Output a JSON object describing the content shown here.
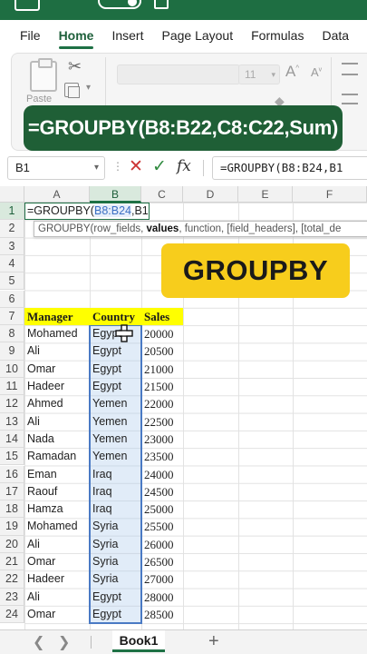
{
  "menu": [
    "File",
    "Home",
    "Insert",
    "Page Layout",
    "Formulas",
    "Data"
  ],
  "menu_active": "Home",
  "ribbon": {
    "paste_label": "Paste",
    "font_size": "11"
  },
  "banner": "=GROUPBY(B8:B22,C8:C22,Sum)",
  "formula_bar": {
    "name_box": "B1",
    "formula": "=GROUPBY(B8:B24,B1"
  },
  "columns": [
    "A",
    "B",
    "C",
    "D",
    "E",
    "F"
  ],
  "selected_column": "B",
  "rows": [
    "1",
    "2",
    "3",
    "4",
    "5",
    "6",
    "7",
    "8",
    "9",
    "10",
    "11",
    "12",
    "13",
    "14",
    "15",
    "16",
    "17",
    "18",
    "19",
    "20",
    "21",
    "22",
    "23",
    "24"
  ],
  "selected_row": "1",
  "edit_cell": {
    "prefix": "=GROUPBY(",
    "ref": "B8:B24",
    "suffix": ",B1"
  },
  "tooltip": {
    "fn": "GROUPBY(",
    "arg1": "row_fields, ",
    "arg2": "values",
    "rest": ", function, [field_headers], [total_de"
  },
  "table": {
    "headers": [
      "Manager",
      "Country",
      "Sales"
    ],
    "rows": [
      [
        "Mohamed",
        "Egypt",
        "20000"
      ],
      [
        "Ali",
        "Egypt",
        "20500"
      ],
      [
        "Omar",
        "Egypt",
        "21000"
      ],
      [
        "Hadeer",
        "Egypt",
        "21500"
      ],
      [
        "Ahmed",
        "Yemen",
        "22000"
      ],
      [
        "Ali",
        "Yemen",
        "22500"
      ],
      [
        "Nada",
        "Yemen",
        "23000"
      ],
      [
        "Ramadan",
        "Yemen",
        "23500"
      ],
      [
        "Eman",
        "Iraq",
        "24000"
      ],
      [
        "Raouf",
        "Iraq",
        "24500"
      ],
      [
        "Hamza",
        "Iraq",
        "25000"
      ],
      [
        "Mohamed",
        "Syria",
        "25500"
      ],
      [
        "Ali",
        "Syria",
        "26000"
      ],
      [
        "Omar",
        "Syria",
        "26500"
      ],
      [
        "Hadeer",
        "Syria",
        "27000"
      ],
      [
        "Ali",
        "Egypt",
        "28000"
      ],
      [
        "Omar",
        "Egypt",
        "28500"
      ]
    ]
  },
  "badge": "GROUPBY",
  "sheet_tab": "Book1",
  "colors": {
    "excel_green": "#1e7145",
    "banner_bg": "#1f5f36",
    "badge_bg": "#f7cd1c",
    "header_fill": "#ffff00",
    "range_border": "#4a7ac4"
  }
}
